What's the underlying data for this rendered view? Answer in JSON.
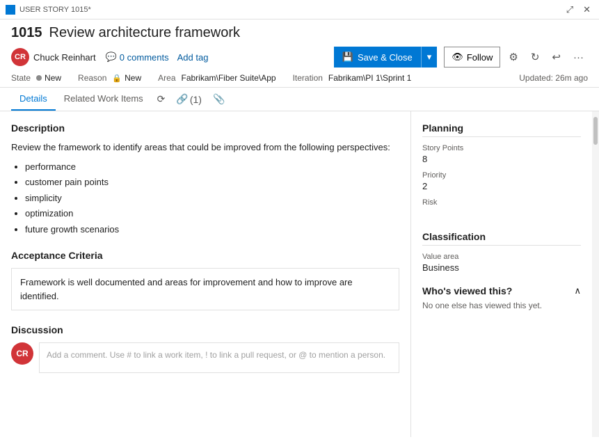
{
  "titleBar": {
    "appName": "USER STORY 1015*",
    "expandIcon": "⤢",
    "closeIcon": "✕"
  },
  "header": {
    "id": "1015",
    "title": "Review architecture framework",
    "author": {
      "initials": "CR",
      "name": "Chuck Reinhart",
      "bgColor": "#d13438"
    },
    "comments": {
      "count": "0 comments",
      "icon": "💬"
    },
    "addTagLabel": "Add tag",
    "saveCloseLabel": "Save & Close",
    "saveIcon": "💾",
    "followLabel": "Follow",
    "followIcon": "👁",
    "settingsIcon": "⚙",
    "refreshIcon": "↻",
    "undoIcon": "↩",
    "moreIcon": "···"
  },
  "meta": {
    "stateLabel": "State",
    "stateValue": "New",
    "reasonLabel": "Reason",
    "reasonValue": "New",
    "areaLabel": "Area",
    "areaValue": "Fabrikam\\Fiber Suite\\App",
    "iterationLabel": "Iteration",
    "iterationValue": "Fabrikam\\PI 1\\Sprint 1",
    "updated": "Updated: 26m ago"
  },
  "tabs": {
    "details": "Details",
    "relatedWorkItems": "Related Work Items",
    "historyIcon": "⟳",
    "linksLabel": "(1)",
    "attachmentsIcon": "🗎"
  },
  "description": {
    "sectionTitle": "Description",
    "text": "Review the framework to identify areas that could be improved from the following perspectives:",
    "bullets": [
      "performance",
      "customer pain points",
      "simplicity",
      "optimization",
      "future growth scenarios"
    ]
  },
  "acceptanceCriteria": {
    "sectionTitle": "Acceptance Criteria",
    "text": "Framework is well documented and areas for improvement and how to improve are identified."
  },
  "discussion": {
    "sectionTitle": "Discussion",
    "placeholder": "Add a comment. Use # to link a work item, ! to link a pull request, or @ to mention a person.",
    "authorInitials": "CR",
    "authorBg": "#d13438"
  },
  "planning": {
    "sectionTitle": "Planning",
    "storyPointsLabel": "Story Points",
    "storyPointsValue": "8",
    "priorityLabel": "Priority",
    "priorityValue": "2",
    "riskLabel": "Risk",
    "riskValue": ""
  },
  "classification": {
    "sectionTitle": "Classification",
    "valueAreaLabel": "Value area",
    "valueAreaValue": "Business"
  },
  "whosViewed": {
    "title": "Who's viewed this?",
    "noViewsText": "No one else has viewed this yet.",
    "collapseIcon": "∧"
  }
}
